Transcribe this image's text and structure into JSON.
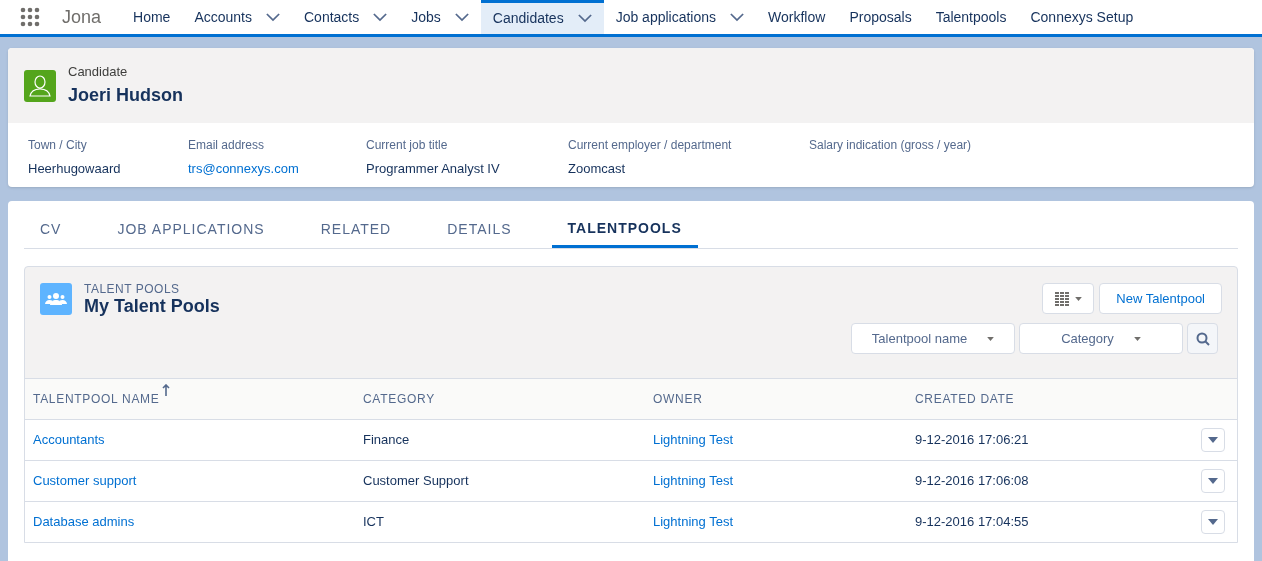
{
  "app": {
    "name": "Jona"
  },
  "nav": [
    {
      "label": "Home",
      "has_menu": false,
      "selected": false
    },
    {
      "label": "Accounts",
      "has_menu": true,
      "selected": false
    },
    {
      "label": "Contacts",
      "has_menu": true,
      "selected": false
    },
    {
      "label": "Jobs",
      "has_menu": true,
      "selected": false
    },
    {
      "label": "Candidates",
      "has_menu": true,
      "selected": true
    },
    {
      "label": "Job applications",
      "has_menu": true,
      "selected": false
    },
    {
      "label": "Workflow",
      "has_menu": false,
      "selected": false
    },
    {
      "label": "Proposals",
      "has_menu": false,
      "selected": false
    },
    {
      "label": "Talentpools",
      "has_menu": false,
      "selected": false
    },
    {
      "label": "Connexys Setup",
      "has_menu": false,
      "selected": false
    }
  ],
  "record": {
    "type": "Candidate",
    "name": "Joeri Hudson",
    "fields": [
      {
        "label": "Town / City",
        "value": "Heerhugowaard",
        "kind": "text"
      },
      {
        "label": "Email address",
        "value": "trs@connexys.com",
        "kind": "link"
      },
      {
        "label": "Current job title",
        "value": "Programmer Analyst IV",
        "kind": "text"
      },
      {
        "label": "Current employer / department",
        "value": "Zoomcast",
        "kind": "text"
      },
      {
        "label": "Salary indication (gross / year)"
      }
    ]
  },
  "tabs": [
    {
      "label": "CV",
      "selected": false
    },
    {
      "label": "JOB APPLICATIONS",
      "selected": false
    },
    {
      "label": "RELATED",
      "selected": false
    },
    {
      "label": "DETAILS",
      "selected": false
    },
    {
      "label": "TALENTPOOLS",
      "selected": true
    }
  ],
  "panel": {
    "overline": "TALENT POOLS",
    "title": "My Talent Pools",
    "new_button": "New Talentpool",
    "filters": [
      {
        "label": "Talentpool name"
      },
      {
        "label": "Category"
      }
    ]
  },
  "table": {
    "columns": [
      {
        "label": "TALENTPOOL NAME",
        "sorted": true
      },
      {
        "label": "CATEGORY",
        "sorted": false
      },
      {
        "label": "OWNER",
        "sorted": false
      },
      {
        "label": "CREATED DATE",
        "sorted": false
      }
    ],
    "rows": [
      {
        "name": "Accountants",
        "category": "Finance",
        "owner": "Lightning Test",
        "created": "9-12-2016 17:06:21"
      },
      {
        "name": "Customer support",
        "category": "Customer Support",
        "owner": "Lightning Test",
        "created": "9-12-2016 17:06:08"
      },
      {
        "name": "Database admins",
        "category": "ICT",
        "owner": "Lightning Test",
        "created": "9-12-2016 17:04:55"
      }
    ]
  }
}
